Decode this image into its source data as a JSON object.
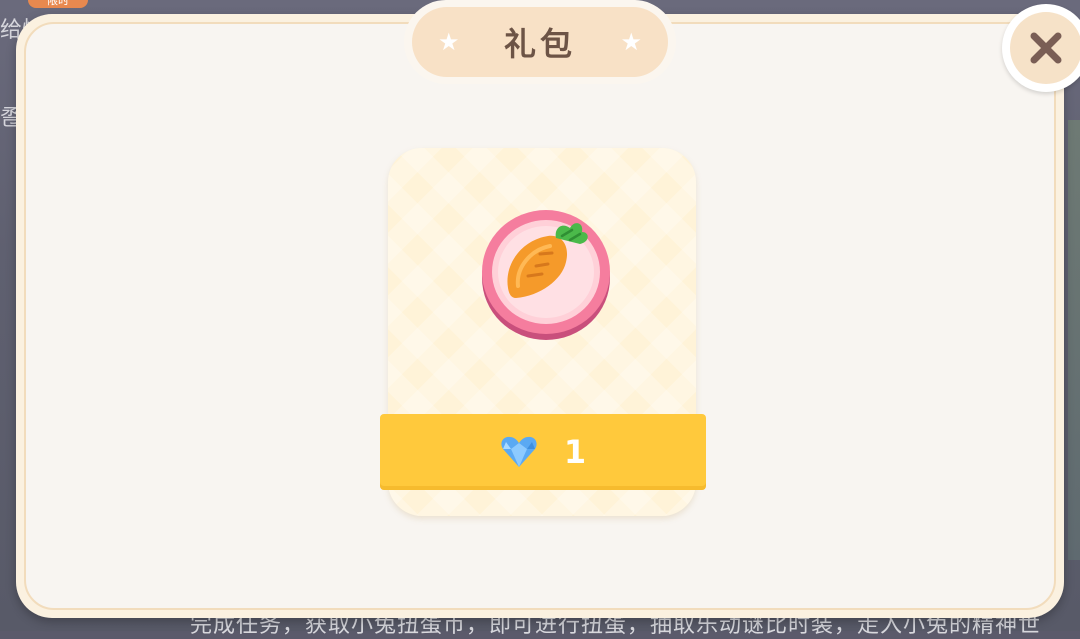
{
  "background": {
    "tag": "限时",
    "left_text_1": "给恰",
    "left_text_2": "卺",
    "bottom_text": "完成任务，获取小兔扭蛋币，即可进行扭蛋，抽取乐动谜比时装，走入小兔的精神世"
  },
  "modal": {
    "title": "礼包",
    "title_star_left": "★",
    "title_star_right": "★",
    "close_icon": "close-icon"
  },
  "gift": {
    "item_icon": "carrot-coin-icon",
    "currency_icon": "blue-heart-gem-icon",
    "price": "1"
  },
  "colors": {
    "modal_bg": "#f8f5f1",
    "title_pill": "#f8e1c6",
    "card_bg": "#fff3d8",
    "ribbon": "#ffc93c",
    "coin_pink": "#f07a9a",
    "carrot": "#f59a2a"
  }
}
